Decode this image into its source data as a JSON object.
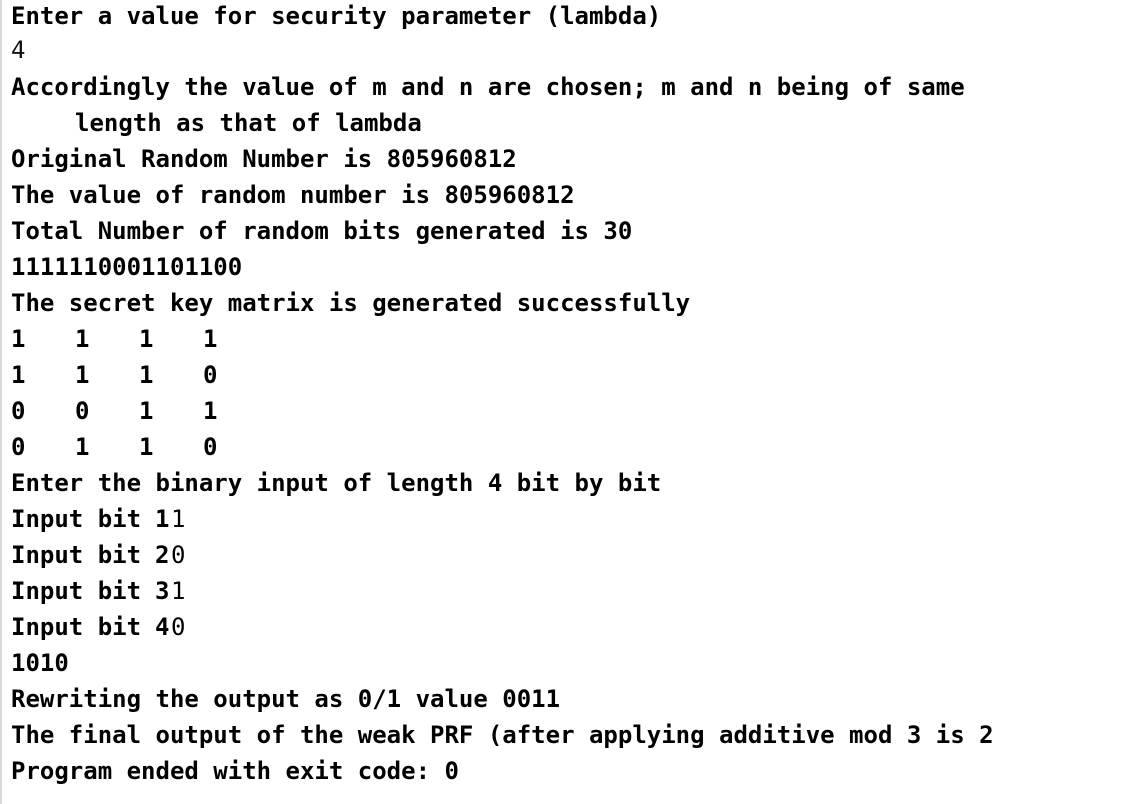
{
  "console": {
    "prompt_lambda": "Enter a value for security parameter (lambda)",
    "lambda_input": "4",
    "chosen_line1": "Accordingly the value of m and n are chosen; m and n being of same",
    "chosen_line2": "length as that of lambda",
    "original_random": "Original Random Number is 805960812",
    "random_value": "The value of random number is 805960812",
    "total_bits": "Total Number of random bits generated is 30",
    "bitstring": "1111110001101100",
    "key_success": "The secret key matrix is generated successfully",
    "matrix": [
      [
        "1",
        "1",
        "1",
        "1"
      ],
      [
        "1",
        "1",
        "1",
        "0"
      ],
      [
        "0",
        "0",
        "1",
        "1"
      ],
      [
        "0",
        "1",
        "1",
        "0"
      ]
    ],
    "enter_binary": "Enter the binary input of length 4 bit by bit",
    "input_bits": [
      {
        "label": "Input bit ",
        "index": "1",
        "value": "1"
      },
      {
        "label": "Input bit ",
        "index": "2",
        "value": "0"
      },
      {
        "label": "Input bit ",
        "index": "3",
        "value": "1"
      },
      {
        "label": "Input bit ",
        "index": "4",
        "value": "0"
      }
    ],
    "input_string": "1010",
    "rewriting": "Rewriting the output as 0/1 value 0011",
    "final_output": "The final output of the weak PRF (after applying additive mod 3 is 2",
    "exit_message": "Program ended with exit code: 0"
  }
}
